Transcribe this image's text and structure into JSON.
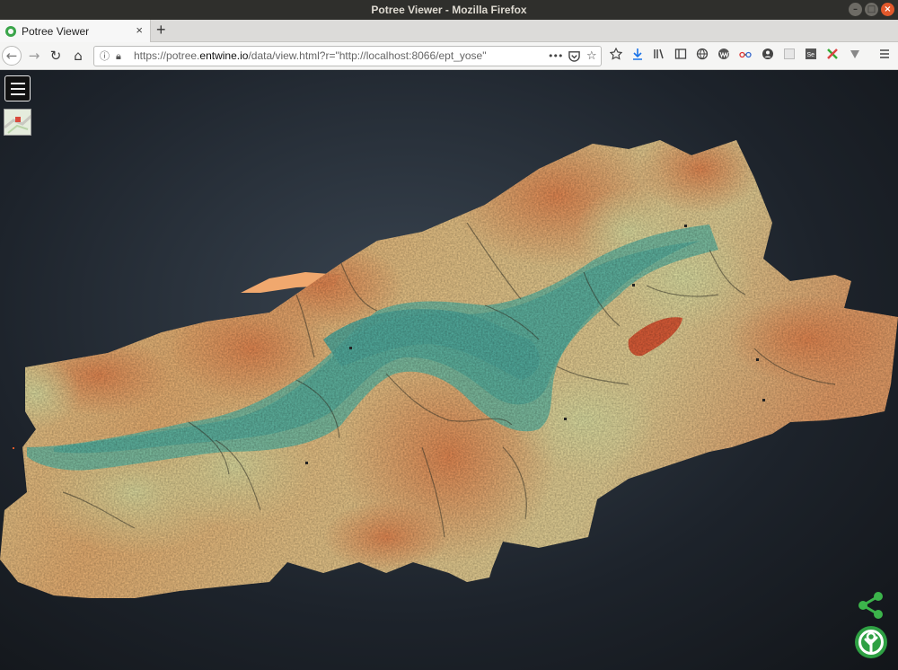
{
  "window": {
    "title": "Potree Viewer - Mozilla Firefox",
    "buttons": [
      "–",
      "□",
      "×"
    ]
  },
  "tabs": [
    {
      "label": "Potree Viewer",
      "close": "×"
    }
  ],
  "newtab": "+",
  "nav": {
    "back": "←",
    "forward": "→",
    "reload": "↻",
    "home": "⌂",
    "url_prefix": "https://potree.",
    "url_domain": "entwine.io",
    "url_path": "/data/view.html?r=\"http://localhost:8066/ept_yose\"",
    "page_actions": "•••",
    "bookmark": "☆"
  },
  "toolbar": {
    "icons": [
      "reading-list-icon",
      "download-icon",
      "library-icon",
      "sidebar-icon",
      "extension-globe-icon",
      "wappalyzer-icon",
      "glasses-icon",
      "account-icon",
      "blank-ext-icon",
      "selenium-icon",
      "puzzle-x-icon",
      "vpn-icon",
      "hamburger-menu-icon"
    ]
  },
  "viewer": {
    "background": "#1d232b",
    "ramp": [
      "#4fb7a3",
      "#86cba3",
      "#d9e1a0",
      "#f2c77f",
      "#f1985b",
      "#e8663c"
    ],
    "share_color": "#3cb44b",
    "logo_color": "#2ea043"
  }
}
